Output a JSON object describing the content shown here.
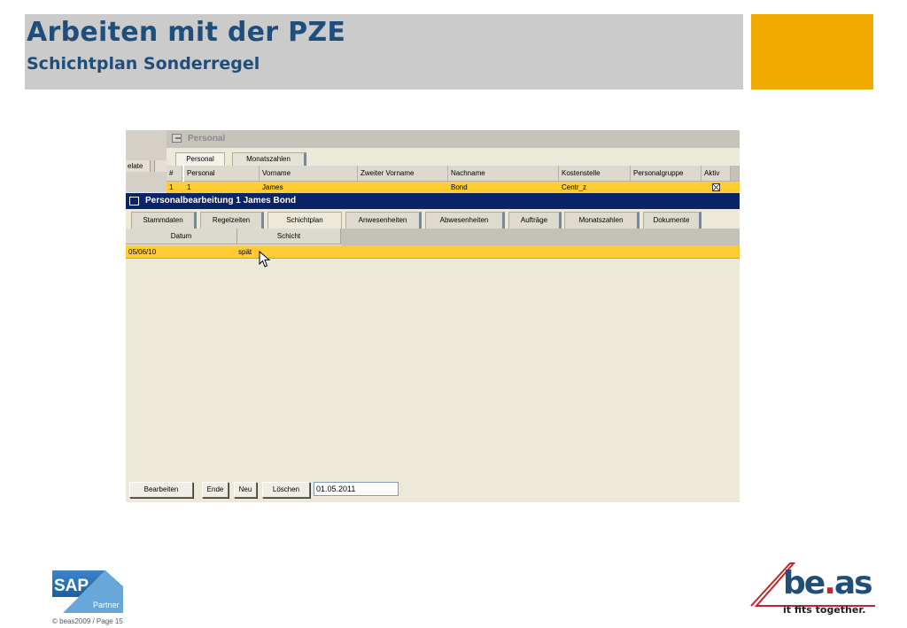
{
  "slide": {
    "title": "Arbeiten mit der PZE",
    "subtitle": "Schichtplan Sonderregel",
    "accent_color": "#f0ab00",
    "title_color": "#1f4e7a"
  },
  "background_window": {
    "left_tab_fragment": "elate",
    "title": "Personal",
    "tabs": [
      "Personal",
      "Monatszahlen"
    ],
    "active_tab": "Personal",
    "columns": [
      "#",
      "Personal",
      "Vorname",
      "Zweiter Vorname",
      "Nachname",
      "Kostenstelle",
      "Personalgruppe",
      "Aktiv"
    ],
    "row": {
      "num": "1",
      "personal": "1",
      "vorname": "James",
      "zweiter_vorname": "",
      "nachname": "Bond",
      "kostenstelle": "Centr_z",
      "personalgruppe": "",
      "aktiv": "checked"
    }
  },
  "edit_window": {
    "title": "Personalbearbeitung 1 James Bond",
    "title_bar_color": "#0a246a",
    "tabs": [
      "Stammdaten",
      "Regelzeiten",
      "Schichtplan",
      "Anwesenheiten",
      "Abwesenheiten",
      "Aufträge",
      "Monatszahlen",
      "Dokumente"
    ],
    "active_tab": "Schichtplan",
    "grid": {
      "columns": [
        "Datum",
        "Schicht"
      ],
      "rows": [
        {
          "datum": "05/06/10",
          "schicht": "spät"
        }
      ],
      "selected_row_color": "#ffcc33"
    },
    "buttons": {
      "bearbeiten": "Bearbeiten",
      "ende": "Ende",
      "neu": "Neu",
      "loeschen": "Löschen"
    },
    "date_field": {
      "value": "01.05.2011"
    }
  },
  "footer": {
    "sap_logo_text": "SAP",
    "sap_partner_text": "Partner",
    "copyright": "© beas2009 / Page 15",
    "beas_logo": {
      "prefix": "be",
      "dot": ".",
      "suffix": "as"
    },
    "beas_tagline": "it fits together."
  }
}
